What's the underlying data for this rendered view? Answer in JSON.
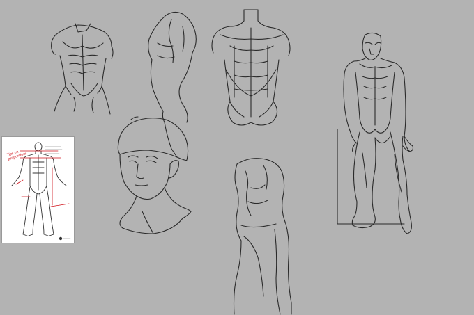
{
  "sheet": {
    "background": "#b3b3b3",
    "stroke_color": "#2a2a2a",
    "figures": [
      "torso-front-sketch",
      "torso-three-quarter-sketch",
      "torso-back-sketch",
      "head-with-cap-sketch",
      "torso-side-sketch",
      "full-body-standing-sketch"
    ]
  },
  "reference": {
    "annotation": "Tips on proportions",
    "accent_color": "#d0141c"
  }
}
